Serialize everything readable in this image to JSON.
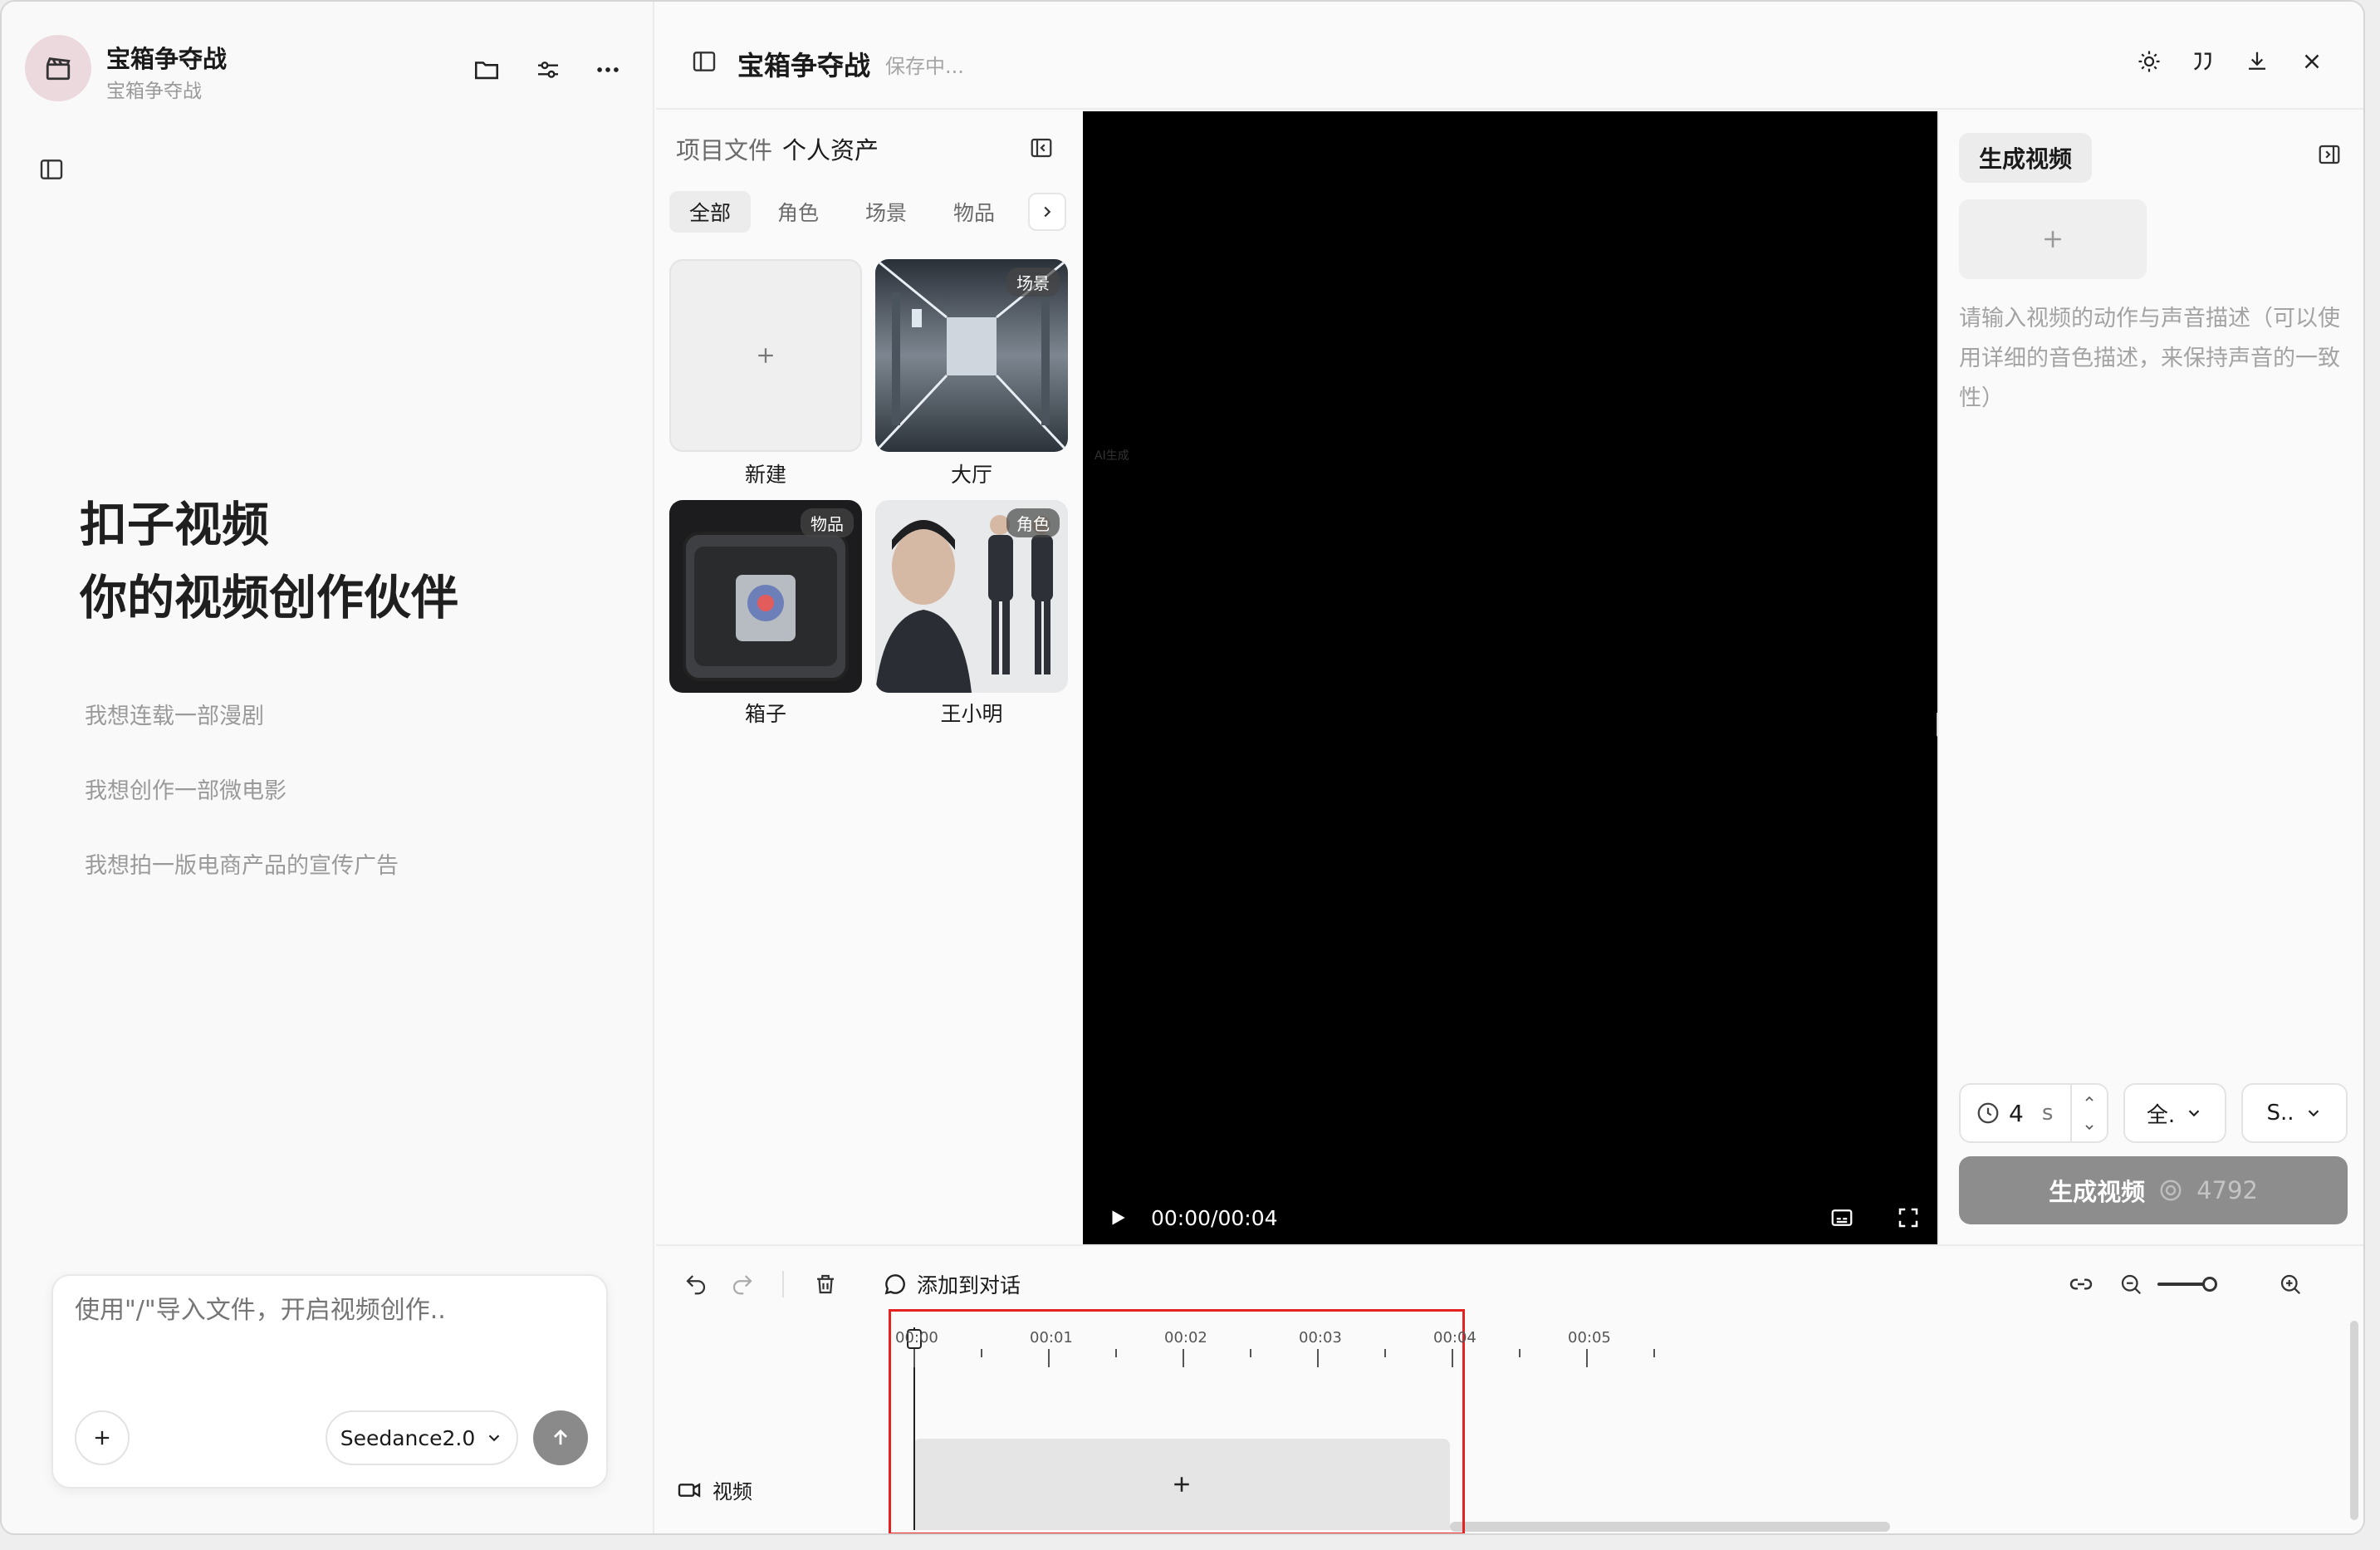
{
  "project": {
    "title": "宝箱争夺战",
    "subtitle": "宝箱争夺战"
  },
  "hero": {
    "line1": "扣子视频",
    "line2": "你的视频创作伙伴"
  },
  "suggestions": [
    "我想连载一部漫剧",
    "我想创作一部微电影",
    "我想拍一版电商产品的宣传广告"
  ],
  "chat": {
    "placeholder": "使用\"/\"导入文件，开启视频创作..",
    "model": "Seedance2.0"
  },
  "editor": {
    "title": "宝箱争夺战",
    "status": "保存中..."
  },
  "assets": {
    "tabs": [
      "项目文件",
      "个人资产"
    ],
    "filters": [
      "全部",
      "角色",
      "场景",
      "物品"
    ],
    "active_filter": "全部",
    "items": [
      {
        "label": "新建",
        "badge": ""
      },
      {
        "label": "大厅",
        "badge": "场景"
      },
      {
        "label": "箱子",
        "badge": "物品"
      },
      {
        "label": "王小明",
        "badge": "角色"
      }
    ]
  },
  "player": {
    "time": "00:00/00:04",
    "watermark": "AI生成"
  },
  "generate": {
    "tab": "生成视频",
    "prompt_placeholder": "请输入视频的动作与声音描述（可以使用详细的音色描述，来保持声音的一致性）",
    "duration_value": "4",
    "duration_unit": "s",
    "ratio_value": "全.",
    "quality_value": "S..",
    "button_label": "生成视频",
    "credits": "4792"
  },
  "timeline": {
    "add_to_chat": "添加到对话",
    "track_label": "视频",
    "ticks": [
      "00:00",
      "00:01",
      "00:02",
      "00:03",
      "00:04",
      "00:05"
    ],
    "zoom": 0.9
  },
  "colors": {
    "accent_selection": "#e52222",
    "button_disabled": "#8d8d8d"
  }
}
